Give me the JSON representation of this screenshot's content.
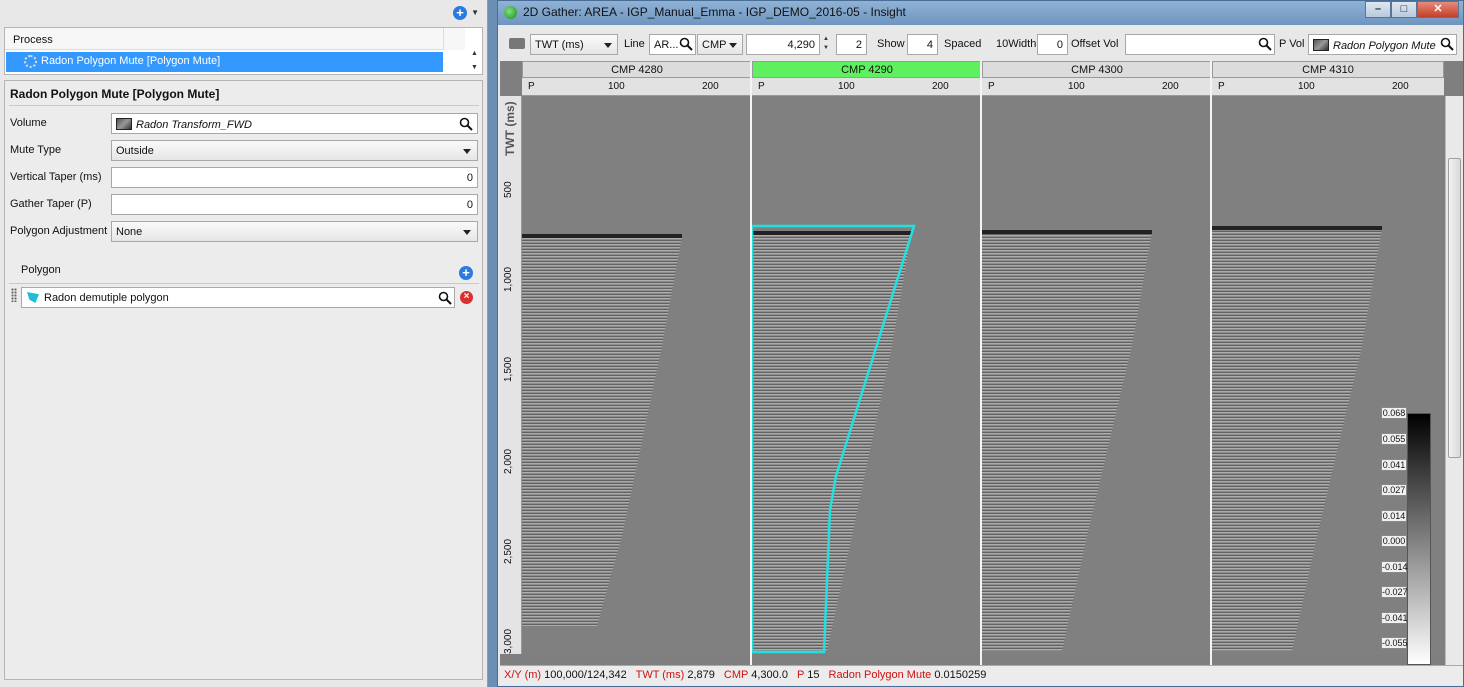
{
  "left": {
    "process_header": "Process",
    "process_item": "Radon Polygon Mute [Polygon Mute]",
    "params_title": "Radon Polygon Mute [Polygon Mute]",
    "volume_label": "Volume",
    "volume_value": "Radon Transform_FWD",
    "mute_type_label": "Mute Type",
    "mute_type_value": "Outside",
    "vertical_taper_label": "Vertical Taper (ms)",
    "vertical_taper_value": "0",
    "gather_taper_label": "Gather Taper (P)",
    "gather_taper_value": "0",
    "polygon_adjust_label": "Polygon Adjustment",
    "polygon_adjust_value": "None",
    "polygon_label": "Polygon",
    "polygon_value": "Radon demutiple polygon"
  },
  "window": {
    "title": "2D Gather: AREA - IGP_Manual_Emma - IGP_DEMO_2016-05 - Insight"
  },
  "toolbar": {
    "domain": "TWT (ms)",
    "line_label": "Line",
    "line_value": "AR...",
    "cmp_select": "CMP",
    "cmp_value": "4,290",
    "step_value": "2",
    "show_label": "Show",
    "show_value": "4",
    "spaced_label": "Spaced",
    "width_label": "10Width",
    "width_value": "0",
    "offset_vol_label": "Offset Vol",
    "offset_vol_value": "",
    "pvol_label": "P Vol",
    "pvol_value": "Radon Polygon Mute"
  },
  "gather": {
    "columns": [
      {
        "label": "CMP 4280",
        "active": false
      },
      {
        "label": "CMP 4290",
        "active": true
      },
      {
        "label": "CMP 4300",
        "active": false
      },
      {
        "label": "CMP 4310",
        "active": false
      }
    ],
    "p_tick_labels": [
      "P",
      "100",
      "200"
    ],
    "y_title": "TWT (ms)",
    "y_ticks": [
      "500",
      "1,000",
      "1,500",
      "2,000",
      "2,500",
      "3,000"
    ],
    "colorbar_ticks": [
      "0.068",
      "0.055",
      "0.041",
      "0.027",
      "0.014",
      "0.000",
      "-0.014",
      "-0.027",
      "-0.041",
      "-0.055"
    ],
    "polygon_color": "#22e0e0",
    "active_color": "#5ef05e"
  },
  "status": {
    "xy_label": "X/Y (m)",
    "xy_value": "100,000/124,342",
    "twt_label": "TWT (ms)",
    "twt_value": "2,879",
    "cmp_label": "CMP",
    "cmp_value": "4,300.0",
    "p_label": "P",
    "p_value": "15",
    "vol_label": "Radon Polygon Mute",
    "vol_value": "0.0150259"
  }
}
